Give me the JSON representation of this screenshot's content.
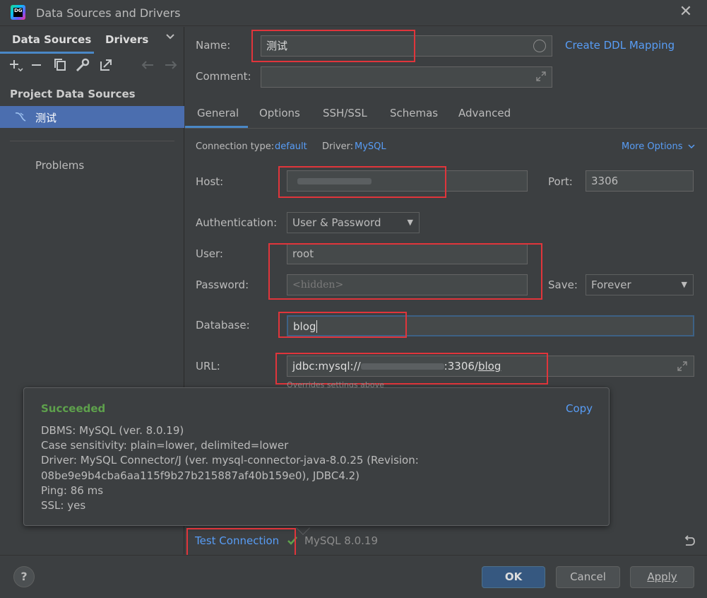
{
  "window": {
    "title": "Data Sources and Drivers"
  },
  "left": {
    "tabs": {
      "data_sources": "Data Sources",
      "drivers": "Drivers"
    },
    "section_title": "Project Data Sources",
    "selected_item": "测试",
    "problems": "Problems"
  },
  "form": {
    "name_label": "Name:",
    "name_value": "测试",
    "create_ddl": "Create DDL Mapping",
    "comment_label": "Comment:",
    "tabs": [
      "General",
      "Options",
      "SSH/SSL",
      "Schemas",
      "Advanced"
    ],
    "connection_type_label": "Connection type:",
    "connection_type_value": "default",
    "driver_label": "Driver:",
    "driver_value": "MySQL",
    "more_options": "More Options",
    "host_label": "Host:",
    "port_label": "Port:",
    "port_value": "3306",
    "auth_label": "Authentication:",
    "auth_value": "User & Password",
    "user_label": "User:",
    "user_value": "root",
    "password_label": "Password:",
    "password_placeholder": "<hidden>",
    "save_label": "Save:",
    "save_value": "Forever",
    "database_label": "Database:",
    "database_value": "blog",
    "url_label": "URL:",
    "url_prefix": "jdbc:mysql://",
    "url_suffix": ":3306/",
    "url_db": "blog",
    "url_note": "Overrides settings above"
  },
  "popup": {
    "status": "Succeeded",
    "copy": "Copy",
    "lines": [
      "DBMS: MySQL (ver. 8.0.19)",
      "Case sensitivity: plain=lower, delimited=lower",
      "Driver: MySQL Connector/J (ver. mysql-connector-java-8.0.25 (Revision:",
      "08be9e9b4cba6aa115f9b27b215887af40b159e0), JDBC4.2)",
      "Ping: 86 ms",
      "SSL: yes"
    ]
  },
  "bottom": {
    "test_connection": "Test Connection",
    "server_version": "MySQL 8.0.19",
    "ok": "OK",
    "cancel": "Cancel",
    "apply": "Apply",
    "help": "?"
  },
  "colors": {
    "accent": "#4a88c7",
    "link": "#589df6",
    "success": "#5ea14c",
    "highlight": "#e0353b",
    "selection": "#4b6eaf"
  }
}
